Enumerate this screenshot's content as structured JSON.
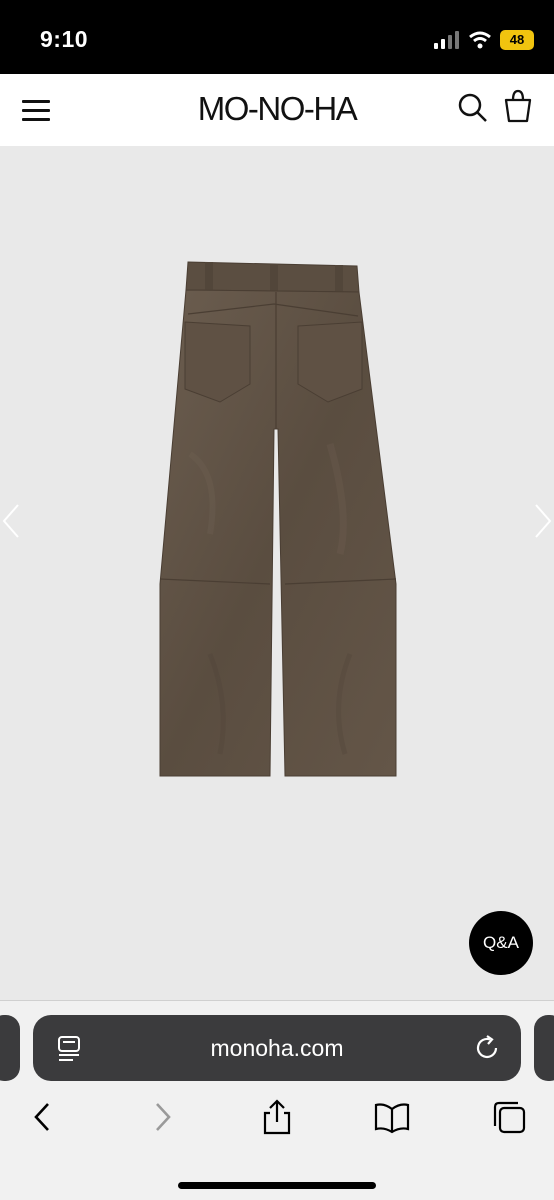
{
  "status_bar": {
    "time": "9:10",
    "battery": "48"
  },
  "header": {
    "logo": "MO-NO-HA"
  },
  "product": {
    "qa_label": "Q&A"
  },
  "browser": {
    "url": "monoha.com"
  },
  "colors": {
    "fabric": "#5e5144",
    "header_bg": "#ffffff",
    "page_bg": "#e9e9e9",
    "qa_bg": "#000000",
    "url_pill": "#3b3b3d",
    "battery": "#f1c40f"
  },
  "icons": [
    "menu-icon",
    "search-icon",
    "bag-icon",
    "chevron-left-icon",
    "chevron-right-icon",
    "reader-icon",
    "reload-icon",
    "back-icon",
    "forward-icon",
    "share-icon",
    "bookmarks-icon",
    "tabs-icon"
  ]
}
